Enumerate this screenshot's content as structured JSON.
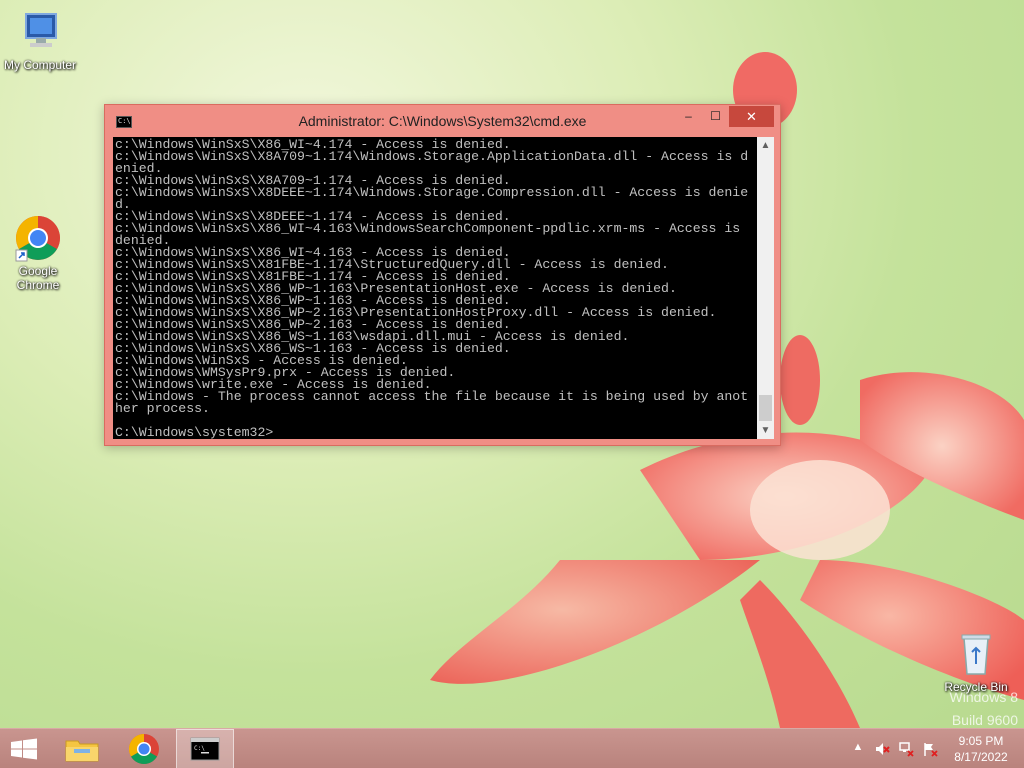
{
  "desktop": {
    "icons": [
      {
        "label": "My Computer",
        "icon": "computer-icon"
      },
      {
        "label": "Google Chrome",
        "icon": "chrome-icon"
      },
      {
        "label": "Recycle Bin",
        "icon": "recycle-bin-icon"
      }
    ],
    "watermark_line1": "Windows 8",
    "watermark_line2": "Build 9600"
  },
  "window": {
    "title": "Administrator: C:\\Windows\\System32\\cmd.exe",
    "icon": "cmd-icon",
    "minimize": "–",
    "maximize": "☐",
    "close": "✕",
    "console_lines": [
      "c:\\Windows\\WinSxS\\X86_WI~4.174 - Access is denied.",
      "c:\\Windows\\WinSxS\\X8A709~1.174\\Windows.Storage.ApplicationData.dll - Access is d",
      "enied.",
      "c:\\Windows\\WinSxS\\X8A709~1.174 - Access is denied.",
      "c:\\Windows\\WinSxS\\X8DEEE~1.174\\Windows.Storage.Compression.dll - Access is denie",
      "d.",
      "c:\\Windows\\WinSxS\\X8DEEE~1.174 - Access is denied.",
      "c:\\Windows\\WinSxS\\X86_WI~4.163\\WindowsSearchComponent-ppdlic.xrm-ms - Access is",
      "denied.",
      "c:\\Windows\\WinSxS\\X86_WI~4.163 - Access is denied.",
      "c:\\Windows\\WinSxS\\X81FBE~1.174\\StructuredQuery.dll - Access is denied.",
      "c:\\Windows\\WinSxS\\X81FBE~1.174 - Access is denied.",
      "c:\\Windows\\WinSxS\\X86_WP~1.163\\PresentationHost.exe - Access is denied.",
      "c:\\Windows\\WinSxS\\X86_WP~1.163 - Access is denied.",
      "c:\\Windows\\WinSxS\\X86_WP~2.163\\PresentationHostProxy.dll - Access is denied.",
      "c:\\Windows\\WinSxS\\X86_WP~2.163 - Access is denied.",
      "c:\\Windows\\WinSxS\\X86_WS~1.163\\wsdapi.dll.mui - Access is denied.",
      "c:\\Windows\\WinSxS\\X86_WS~1.163 - Access is denied.",
      "c:\\Windows\\WinSxS - Access is denied.",
      "c:\\Windows\\WMSysPr9.prx - Access is denied.",
      "c:\\Windows\\write.exe - Access is denied.",
      "c:\\Windows - The process cannot access the file because it is being used by anot",
      "her process.",
      "",
      "C:\\Windows\\system32>"
    ],
    "scroll_up": "▲",
    "scroll_down": "▼"
  },
  "taskbar": {
    "start_icon": "windows-logo-icon",
    "apps": [
      {
        "name": "File Explorer",
        "icon": "folder-icon"
      },
      {
        "name": "Google Chrome",
        "icon": "chrome-icon"
      },
      {
        "name": "Command Prompt",
        "icon": "cmd-icon"
      }
    ],
    "tray": {
      "show_hidden": "▲",
      "volume_icon": "speaker-muted-icon",
      "network_icon": "network-icon",
      "flag_icon": "action-center-icon"
    },
    "clock_time": "9:05 PM",
    "clock_date": "8/17/2022"
  }
}
